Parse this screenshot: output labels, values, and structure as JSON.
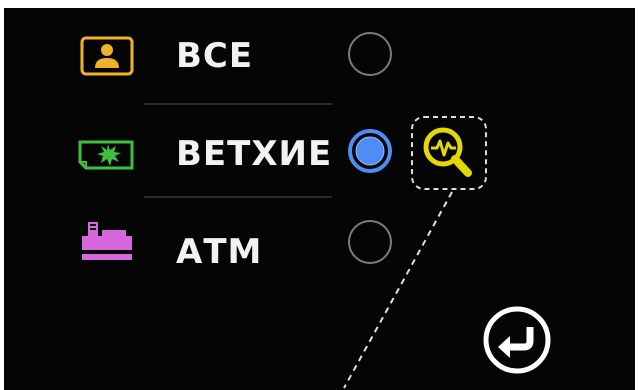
{
  "menu": {
    "items": [
      {
        "label": "ВСЕ",
        "icon": "person-card-icon",
        "icon_color": "#f0b229",
        "selected": false
      },
      {
        "label": "ВЕТХИЕ",
        "icon": "damaged-banknote-icon",
        "icon_color": "#3fbf3f",
        "selected": true
      },
      {
        "label": "АТМ",
        "icon": "cash-register-icon",
        "icon_color": "#d667dc",
        "selected": false
      }
    ]
  },
  "actions": {
    "inspect_icon": "magnifier-waveform-icon",
    "back_icon": "return-arrow-icon"
  },
  "colors": {
    "background": "#050505",
    "text": "#f2f2f2",
    "radio_selected": "#4f8df5",
    "radio_outline": "#7a7a7a",
    "inspect_icon": "#e4d800",
    "back_icon": "#ffffff"
  }
}
